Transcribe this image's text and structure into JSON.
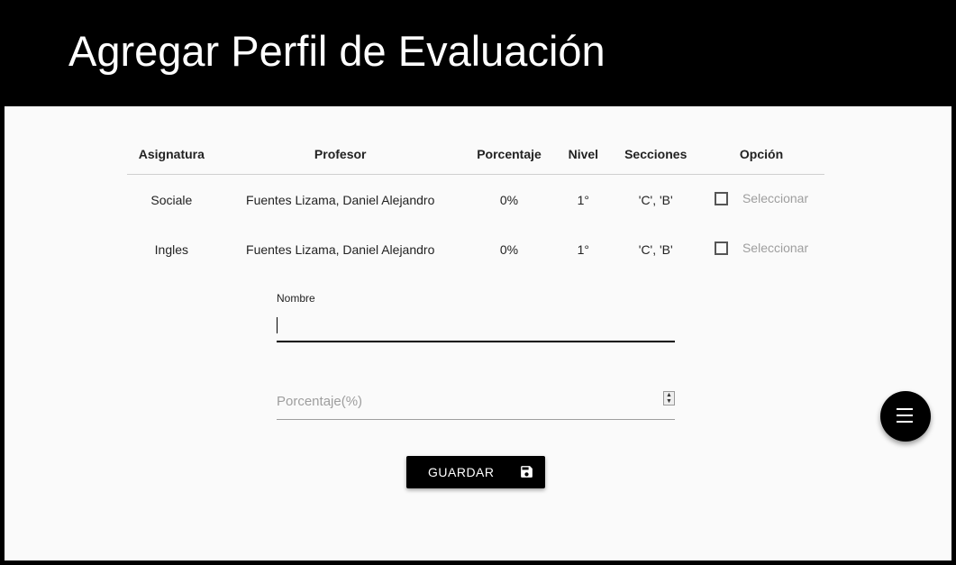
{
  "header": {
    "title": "Agregar Perfil de Evaluación"
  },
  "table": {
    "columns": [
      "Asignatura",
      "Profesor",
      "Porcentaje",
      "Nivel",
      "Secciones",
      "Opción"
    ],
    "rows": [
      {
        "asignatura": "Sociale",
        "profesor": "Fuentes Lizama, Daniel Alejandro",
        "porcentaje": "0%",
        "nivel": "1°",
        "secciones": "'C', 'B'",
        "opcion": "Seleccionar",
        "checked": false
      },
      {
        "asignatura": "Ingles",
        "profesor": "Fuentes Lizama, Daniel Alejandro",
        "porcentaje": "0%",
        "nivel": "1°",
        "secciones": "'C', 'B'",
        "opcion": "Seleccionar",
        "checked": false
      }
    ]
  },
  "form": {
    "nombre_label": "Nombre",
    "nombre_value": "",
    "porcentaje_placeholder": "Porcentaje(%)"
  },
  "actions": {
    "save_label": "GUARDAR",
    "save_icon": "floppy-disk-icon",
    "fab_icon": "menu-icon"
  },
  "colors": {
    "header_bg": "#000000",
    "card_bg": "#fafafa",
    "button_bg": "#000000",
    "muted_text": "#9e9e9e"
  }
}
